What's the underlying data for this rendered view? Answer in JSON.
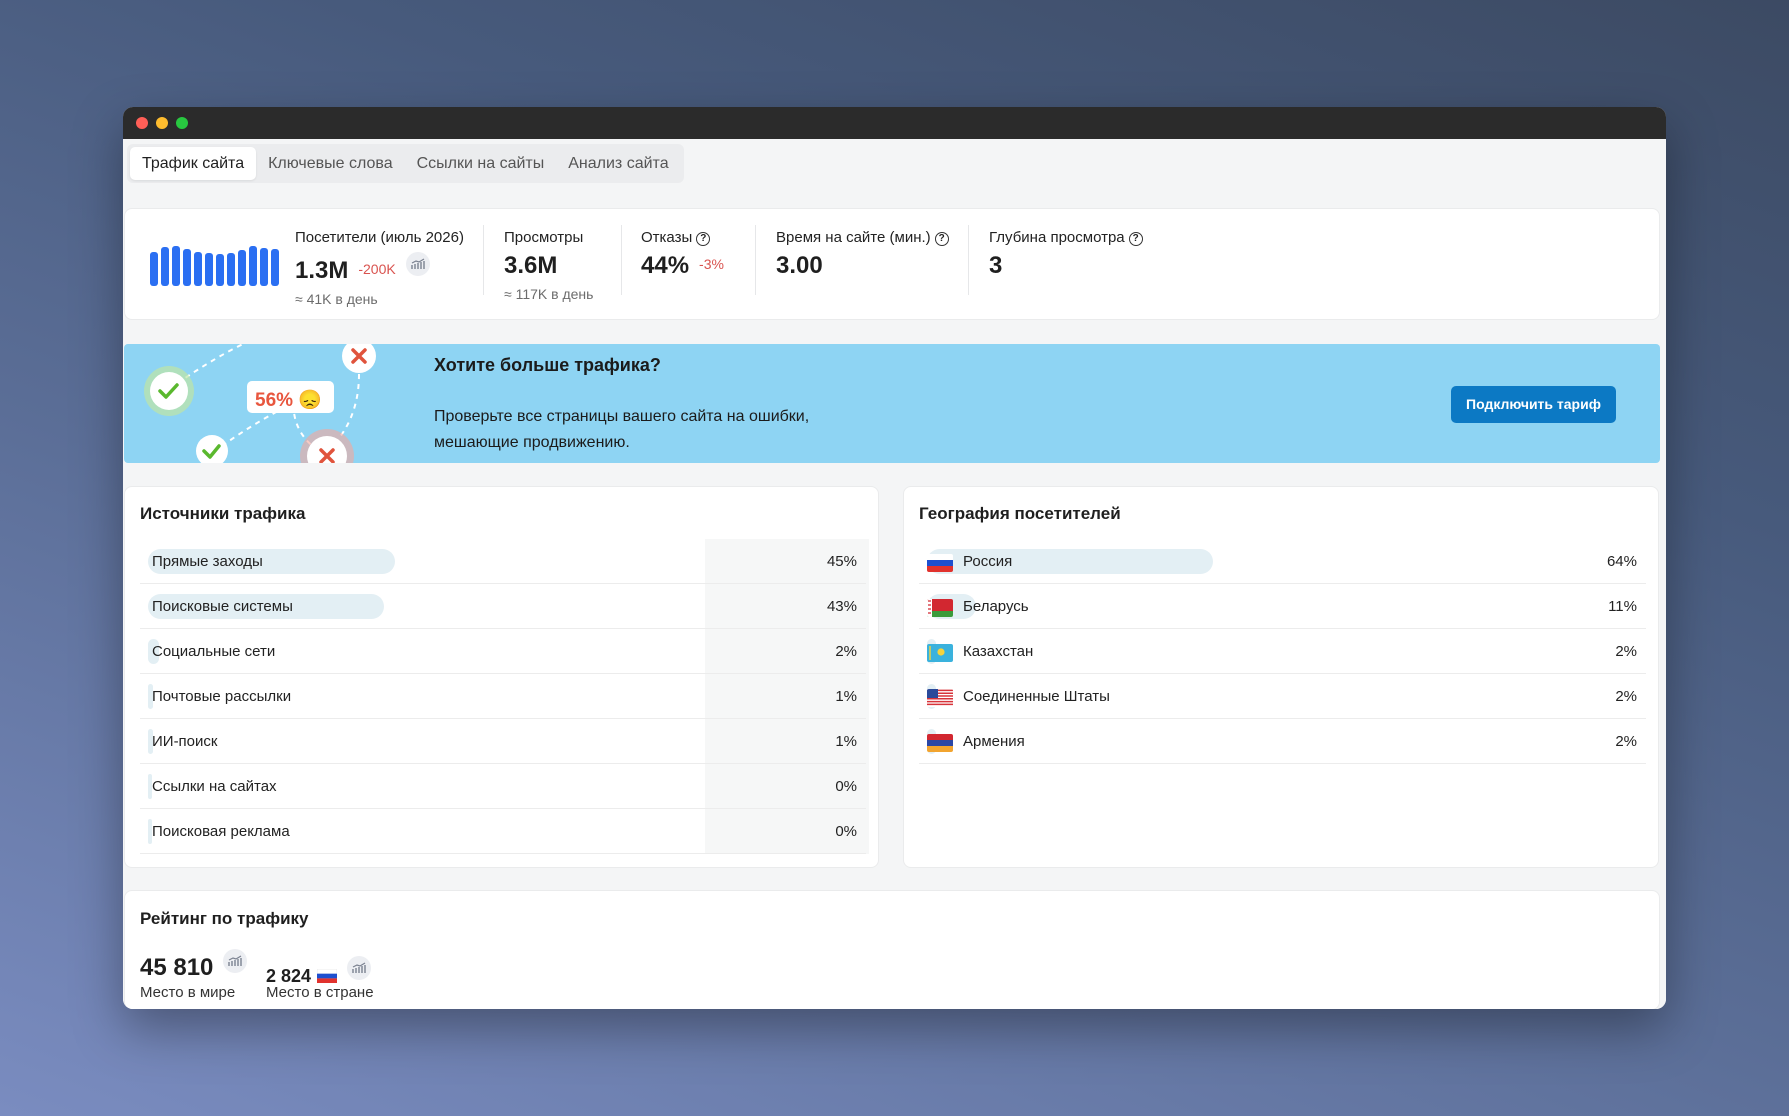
{
  "tabs": [
    "Трафик сайта",
    "Ключевые слова",
    "Ссылки на сайты",
    "Анализ сайта"
  ],
  "stats": {
    "visitors_label": "Посетители (июль 2026)",
    "visitors_value": "1.3M",
    "visitors_delta": "-200K",
    "visitors_sub": "≈ 41K в день",
    "views_label": "Просмотры",
    "views_value": "3.6M",
    "views_sub": "≈ 117K в день",
    "bounce_label": "Отказы",
    "bounce_value": "44%",
    "bounce_delta": "-3%",
    "time_label": "Время на сайте (мин.)",
    "time_value": "3.00",
    "depth_label": "Глубина просмотра",
    "depth_value": "3",
    "mini_bar_levels": [
      0.78,
      0.88,
      0.9,
      0.84,
      0.78,
      0.74,
      0.72,
      0.76,
      0.82,
      0.9,
      0.86,
      0.84
    ]
  },
  "banner": {
    "title": "Хотите больше трафика?",
    "text": "Проверьте все страницы вашего сайта на ошибки, мешающие продвижению.",
    "button": "Подключить тариф",
    "badge": "56%",
    "badge_emoji": "😞"
  },
  "sources": {
    "title": "Источники трафика",
    "items": [
      {
        "name": "Прямые заходы",
        "pct": "45%",
        "value": 45
      },
      {
        "name": "Поисковые системы",
        "pct": "43%",
        "value": 43
      },
      {
        "name": "Социальные сети",
        "pct": "2%",
        "value": 2
      },
      {
        "name": "Почтовые рассылки",
        "pct": "1%",
        "value": 1
      },
      {
        "name": "ИИ-поиск",
        "pct": "1%",
        "value": 1
      },
      {
        "name": "Ссылки на сайтах",
        "pct": "0%",
        "value": 0
      },
      {
        "name": "Поисковая реклама",
        "pct": "0%",
        "value": 0
      }
    ]
  },
  "geo": {
    "title": "География посетителей",
    "items": [
      {
        "name": "Россия",
        "pct": "64%",
        "value": 64,
        "flag": "ru"
      },
      {
        "name": "Беларусь",
        "pct": "11%",
        "value": 11,
        "flag": "by"
      },
      {
        "name": "Казахстан",
        "pct": "2%",
        "value": 2,
        "flag": "kz"
      },
      {
        "name": "Соединенные Штаты",
        "pct": "2%",
        "value": 2,
        "flag": "us"
      },
      {
        "name": "Армения",
        "pct": "2%",
        "value": 2,
        "flag": "am"
      }
    ]
  },
  "rating": {
    "title": "Рейтинг по трафику",
    "world_value": "45 810",
    "world_label": "Место в мире",
    "country_value": "2 824",
    "country_label": "Место в стране"
  },
  "colors": {
    "accent": "#2b6ff2",
    "banner_bg": "#8ed4f3",
    "button": "#0c79c4",
    "negative": "#d9534f",
    "bar_fill": "#e3eff4"
  }
}
